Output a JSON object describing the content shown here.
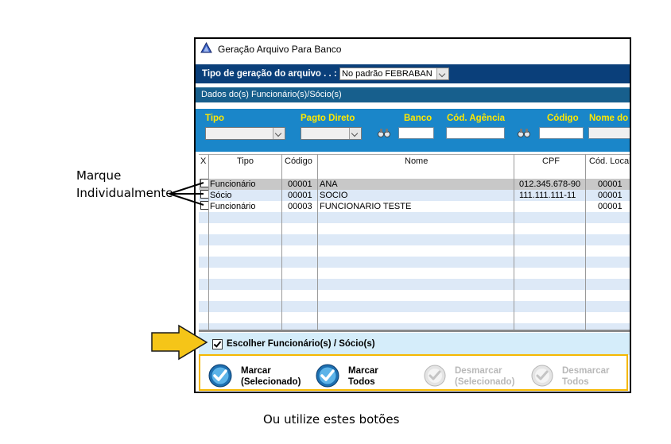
{
  "annotations": {
    "left_line1": "Marque",
    "left_line2": "Individualmente",
    "bottom": "Ou utilize estes botões"
  },
  "window": {
    "title": "Geração Arquivo Para Banco",
    "generation_type_label": "Tipo de geração do arquivo . . :",
    "generation_type_value": "No padrão FEBRABAN",
    "section_title": "Dados do(s) Funcionário(s)/Sócio(s)"
  },
  "filters": {
    "tipo": "Tipo",
    "pagto_direto": "Pagto Direto",
    "banco": "Banco",
    "cod_agencia": "Cód. Agência",
    "codigo": "Código",
    "nome_do": "Nome do"
  },
  "grid": {
    "columns": [
      "X",
      "Tipo",
      "Código",
      "Nome",
      "CPF",
      "Cód. Local"
    ],
    "rows": [
      {
        "tipo": "Funcionário",
        "codigo": "00001",
        "nome": "ANA",
        "cpf": "012.345.678-90",
        "cod_local": "00001"
      },
      {
        "tipo": "Sócio",
        "codigo": "00001",
        "nome": "SOCIO",
        "cpf": "111.111.111-11",
        "cod_local": "00001"
      },
      {
        "tipo": "Funcionário",
        "codigo": "00003",
        "nome": "FUNCIONARIO TESTE",
        "cpf": "",
        "cod_local": "00001"
      }
    ]
  },
  "choose": {
    "label": "Escolher Funcionário(s) / Sócio(s)",
    "checked": true
  },
  "buttons": {
    "mark_selected_1": "Marcar",
    "mark_selected_2": "(Selecionado)",
    "mark_all_1": "Marcar",
    "mark_all_2": "Todos",
    "unmark_selected_1": "Desmarcar",
    "unmark_selected_2": "(Selecionado)",
    "unmark_all_1": "Desmarcar",
    "unmark_all_2": "Todos"
  },
  "colors": {
    "header_dark_blue": "#0a3f7a",
    "filter_blue": "#1a86c9",
    "filter_label_yellow": "#ffe800",
    "highlight_orange": "#f5b800",
    "arrow_yellow": "#f5c518"
  }
}
